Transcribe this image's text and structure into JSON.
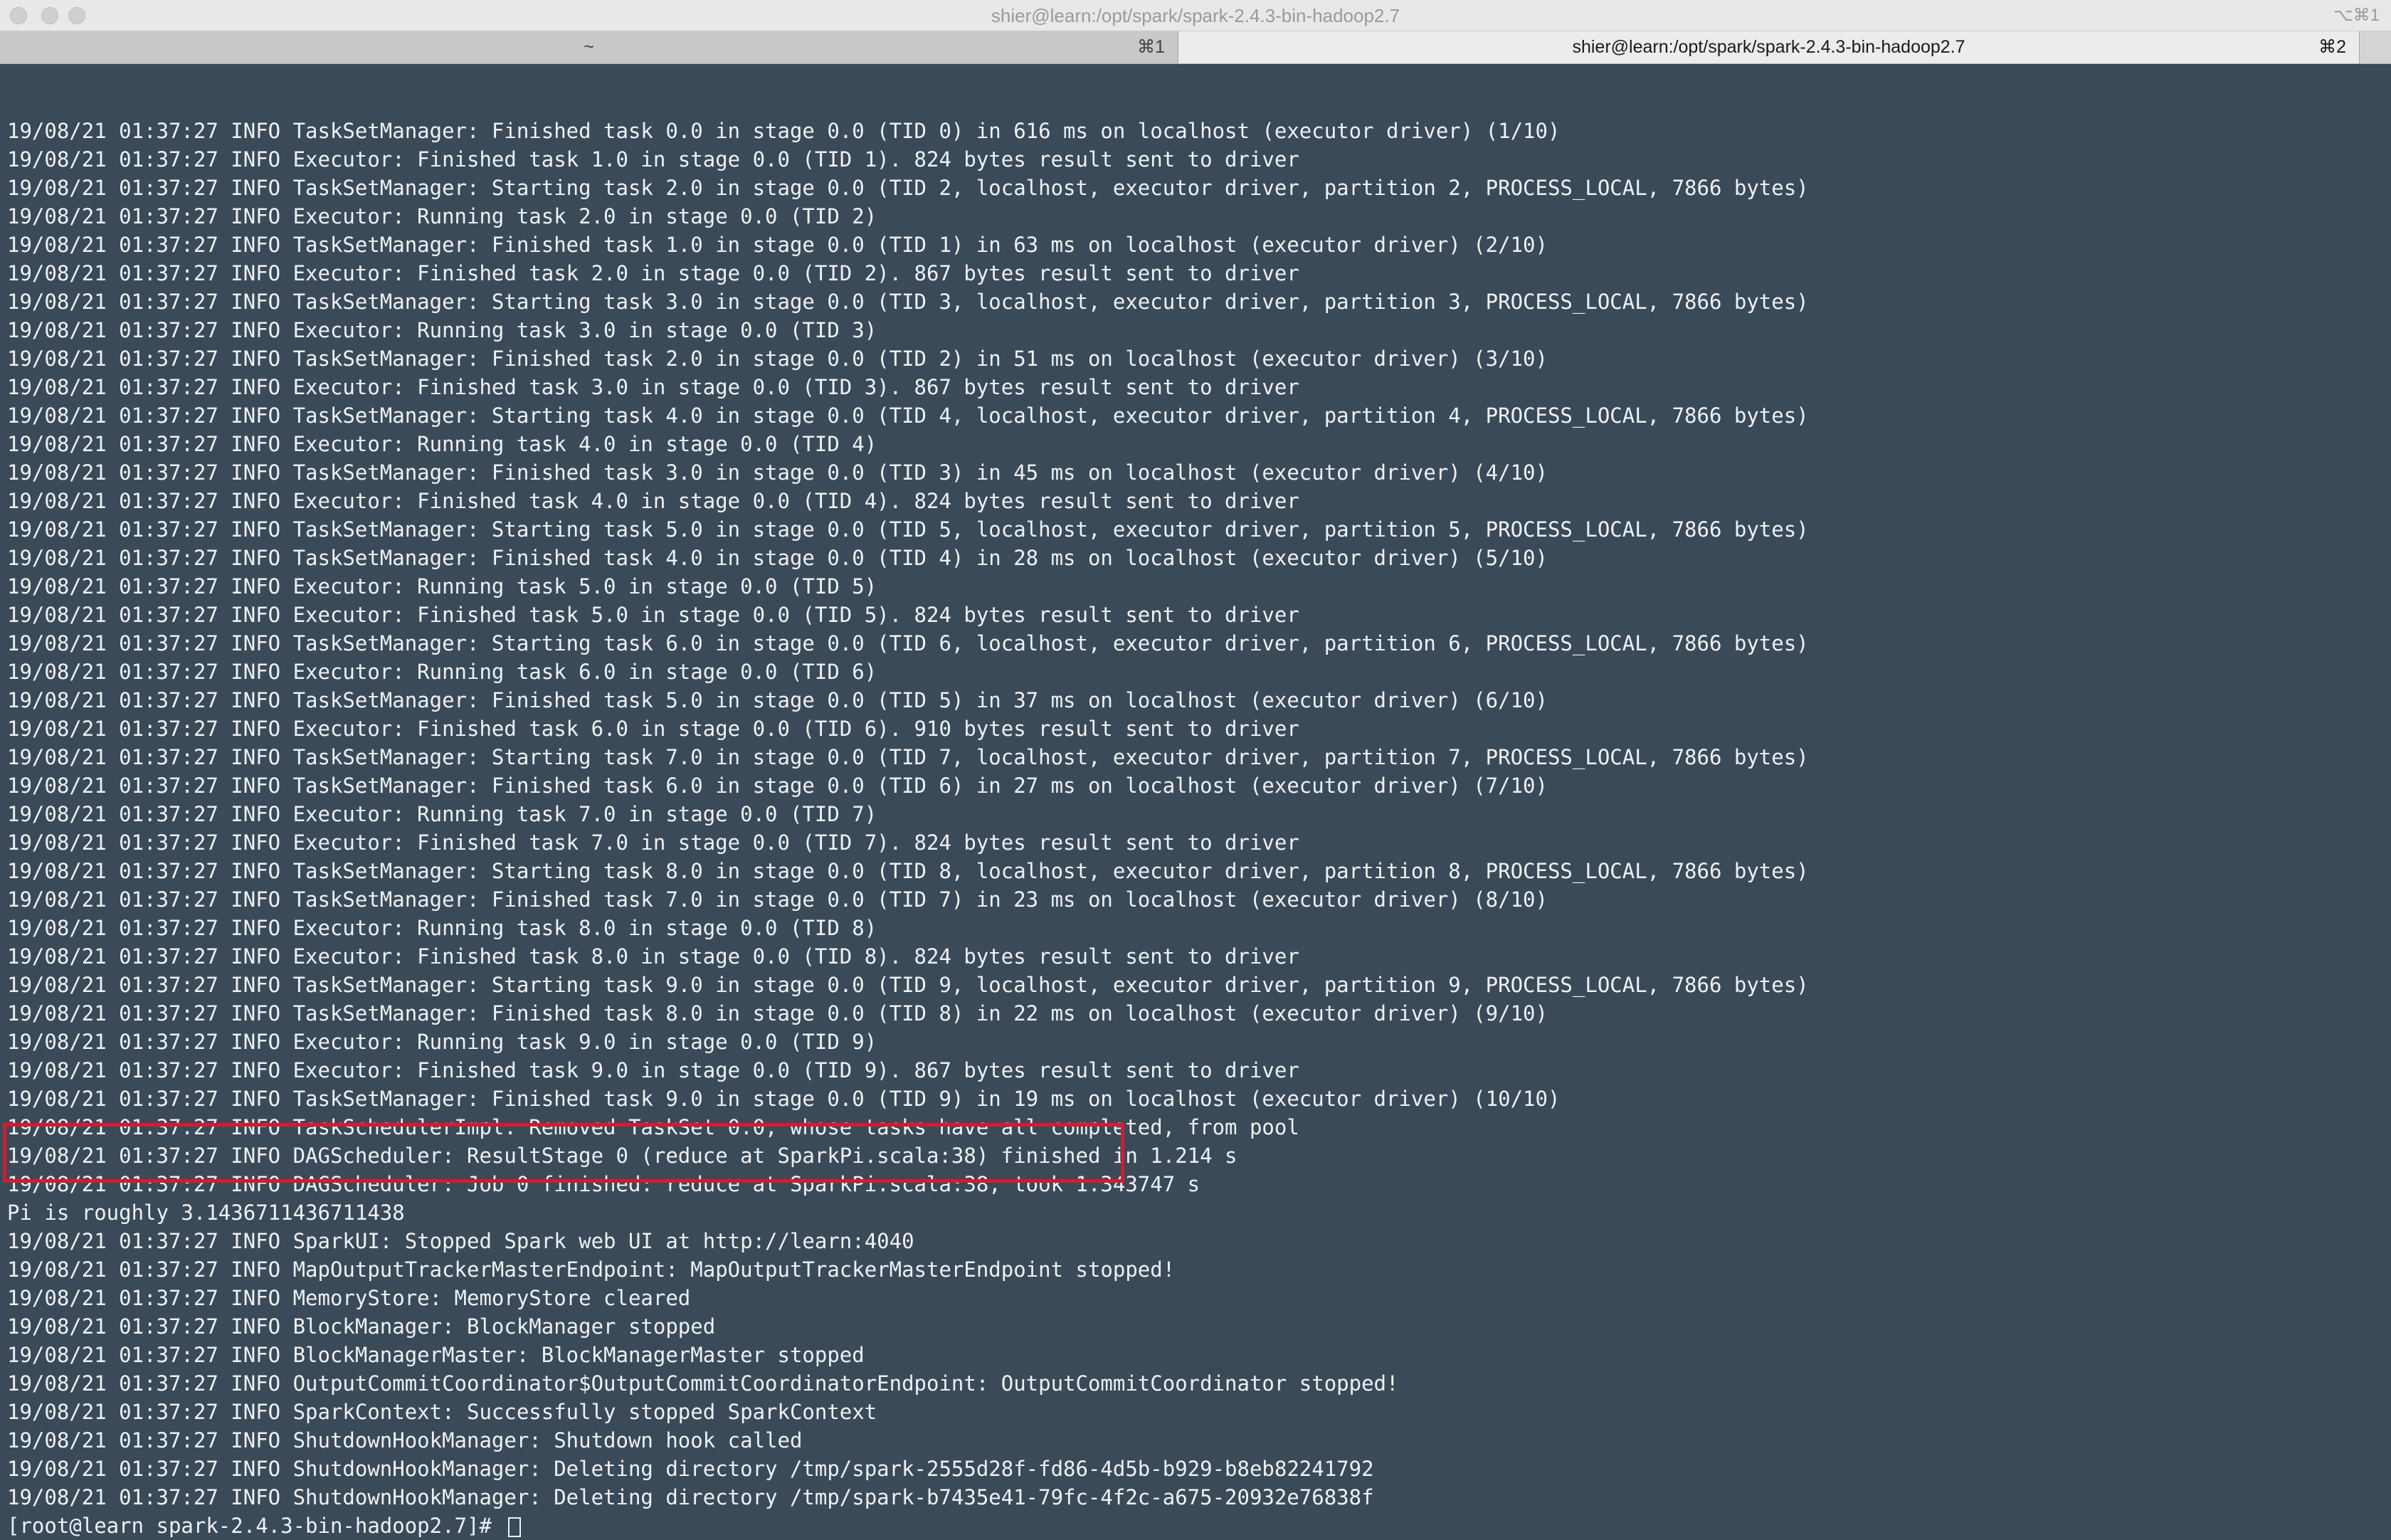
{
  "window": {
    "title": "shier@learn:/opt/spark/spark-2.4.3-bin-hadoop2.7",
    "shortcut": "⌥⌘1"
  },
  "tabs": [
    {
      "label": "~",
      "shortcut": "⌘1"
    },
    {
      "label": "shier@learn:/opt/spark/spark-2.4.3-bin-hadoop2.7",
      "shortcut": "⌘2"
    }
  ],
  "terminal": {
    "lines": [
      "19/08/21 01:37:27 INFO TaskSetManager: Finished task 0.0 in stage 0.0 (TID 0) in 616 ms on localhost (executor driver) (1/10)",
      "19/08/21 01:37:27 INFO Executor: Finished task 1.0 in stage 0.0 (TID 1). 824 bytes result sent to driver",
      "19/08/21 01:37:27 INFO TaskSetManager: Starting task 2.0 in stage 0.0 (TID 2, localhost, executor driver, partition 2, PROCESS_LOCAL, 7866 bytes)",
      "19/08/21 01:37:27 INFO Executor: Running task 2.0 in stage 0.0 (TID 2)",
      "19/08/21 01:37:27 INFO TaskSetManager: Finished task 1.0 in stage 0.0 (TID 1) in 63 ms on localhost (executor driver) (2/10)",
      "19/08/21 01:37:27 INFO Executor: Finished task 2.0 in stage 0.0 (TID 2). 867 bytes result sent to driver",
      "19/08/21 01:37:27 INFO TaskSetManager: Starting task 3.0 in stage 0.0 (TID 3, localhost, executor driver, partition 3, PROCESS_LOCAL, 7866 bytes)",
      "19/08/21 01:37:27 INFO Executor: Running task 3.0 in stage 0.0 (TID 3)",
      "19/08/21 01:37:27 INFO TaskSetManager: Finished task 2.0 in stage 0.0 (TID 2) in 51 ms on localhost (executor driver) (3/10)",
      "19/08/21 01:37:27 INFO Executor: Finished task 3.0 in stage 0.0 (TID 3). 867 bytes result sent to driver",
      "19/08/21 01:37:27 INFO TaskSetManager: Starting task 4.0 in stage 0.0 (TID 4, localhost, executor driver, partition 4, PROCESS_LOCAL, 7866 bytes)",
      "19/08/21 01:37:27 INFO Executor: Running task 4.0 in stage 0.0 (TID 4)",
      "19/08/21 01:37:27 INFO TaskSetManager: Finished task 3.0 in stage 0.0 (TID 3) in 45 ms on localhost (executor driver) (4/10)",
      "19/08/21 01:37:27 INFO Executor: Finished task 4.0 in stage 0.0 (TID 4). 824 bytes result sent to driver",
      "19/08/21 01:37:27 INFO TaskSetManager: Starting task 5.0 in stage 0.0 (TID 5, localhost, executor driver, partition 5, PROCESS_LOCAL, 7866 bytes)",
      "19/08/21 01:37:27 INFO TaskSetManager: Finished task 4.0 in stage 0.0 (TID 4) in 28 ms on localhost (executor driver) (5/10)",
      "19/08/21 01:37:27 INFO Executor: Running task 5.0 in stage 0.0 (TID 5)",
      "19/08/21 01:37:27 INFO Executor: Finished task 5.0 in stage 0.0 (TID 5). 824 bytes result sent to driver",
      "19/08/21 01:37:27 INFO TaskSetManager: Starting task 6.0 in stage 0.0 (TID 6, localhost, executor driver, partition 6, PROCESS_LOCAL, 7866 bytes)",
      "19/08/21 01:37:27 INFO Executor: Running task 6.0 in stage 0.0 (TID 6)",
      "19/08/21 01:37:27 INFO TaskSetManager: Finished task 5.0 in stage 0.0 (TID 5) in 37 ms on localhost (executor driver) (6/10)",
      "19/08/21 01:37:27 INFO Executor: Finished task 6.0 in stage 0.0 (TID 6). 910 bytes result sent to driver",
      "19/08/21 01:37:27 INFO TaskSetManager: Starting task 7.0 in stage 0.0 (TID 7, localhost, executor driver, partition 7, PROCESS_LOCAL, 7866 bytes)",
      "19/08/21 01:37:27 INFO TaskSetManager: Finished task 6.0 in stage 0.0 (TID 6) in 27 ms on localhost (executor driver) (7/10)",
      "19/08/21 01:37:27 INFO Executor: Running task 7.0 in stage 0.0 (TID 7)",
      "19/08/21 01:37:27 INFO Executor: Finished task 7.0 in stage 0.0 (TID 7). 824 bytes result sent to driver",
      "19/08/21 01:37:27 INFO TaskSetManager: Starting task 8.0 in stage 0.0 (TID 8, localhost, executor driver, partition 8, PROCESS_LOCAL, 7866 bytes)",
      "19/08/21 01:37:27 INFO TaskSetManager: Finished task 7.0 in stage 0.0 (TID 7) in 23 ms on localhost (executor driver) (8/10)",
      "19/08/21 01:37:27 INFO Executor: Running task 8.0 in stage 0.0 (TID 8)",
      "19/08/21 01:37:27 INFO Executor: Finished task 8.0 in stage 0.0 (TID 8). 824 bytes result sent to driver",
      "19/08/21 01:37:27 INFO TaskSetManager: Starting task 9.0 in stage 0.0 (TID 9, localhost, executor driver, partition 9, PROCESS_LOCAL, 7866 bytes)",
      "19/08/21 01:37:27 INFO TaskSetManager: Finished task 8.0 in stage 0.0 (TID 8) in 22 ms on localhost (executor driver) (9/10)",
      "19/08/21 01:37:27 INFO Executor: Running task 9.0 in stage 0.0 (TID 9)",
      "19/08/21 01:37:27 INFO Executor: Finished task 9.0 in stage 0.0 (TID 9). 867 bytes result sent to driver",
      "19/08/21 01:37:27 INFO TaskSetManager: Finished task 9.0 in stage 0.0 (TID 9) in 19 ms on localhost (executor driver) (10/10)",
      "19/08/21 01:37:27 INFO TaskSchedulerImpl: Removed TaskSet 0.0, whose tasks have all completed, from pool",
      "19/08/21 01:37:27 INFO DAGScheduler: ResultStage 0 (reduce at SparkPi.scala:38) finished in 1.214 s",
      "19/08/21 01:37:27 INFO DAGScheduler: Job 0 finished: reduce at SparkPi.scala:38, took 1.343747 s",
      "Pi is roughly 3.1436711436711438",
      "19/08/21 01:37:27 INFO SparkUI: Stopped Spark web UI at http://learn:4040",
      "19/08/21 01:37:27 INFO MapOutputTrackerMasterEndpoint: MapOutputTrackerMasterEndpoint stopped!",
      "19/08/21 01:37:27 INFO MemoryStore: MemoryStore cleared",
      "19/08/21 01:37:27 INFO BlockManager: BlockManager stopped",
      "19/08/21 01:37:27 INFO BlockManagerMaster: BlockManagerMaster stopped",
      "19/08/21 01:37:27 INFO OutputCommitCoordinator$OutputCommitCoordinatorEndpoint: OutputCommitCoordinator stopped!",
      "19/08/21 01:37:27 INFO SparkContext: Successfully stopped SparkContext",
      "19/08/21 01:37:27 INFO ShutdownHookManager: Shutdown hook called",
      "19/08/21 01:37:27 INFO ShutdownHookManager: Deleting directory /tmp/spark-2555d28f-fd86-4d5b-b929-b8eb82241792",
      "19/08/21 01:37:27 INFO ShutdownHookManager: Deleting directory /tmp/spark-b7435e41-79fc-4f2c-a675-20932e76838f"
    ],
    "prompt": "[root@learn spark-2.4.3-bin-hadoop2.7]# "
  },
  "colors": {
    "terminal_bg": "#3b4a58",
    "terminal_fg": "#eef1f4",
    "highlight_border": "#d9192f"
  }
}
